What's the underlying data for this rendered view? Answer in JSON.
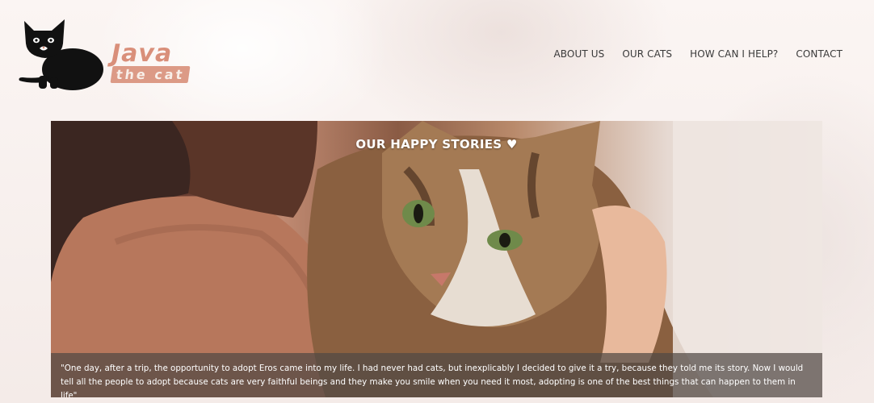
{
  "header": {
    "logo": {
      "line1": "Java",
      "line2": "the cat"
    },
    "nav": [
      {
        "label": "ABOUT US"
      },
      {
        "label": "OUR CATS"
      },
      {
        "label": "HOW CAN I HELP?"
      },
      {
        "label": "CONTACT"
      }
    ]
  },
  "hero": {
    "title": "OUR HAPPY STORIES ♥",
    "quote": "\"One day, after a trip, the opportunity to adopt Eros came into my life. I had never had cats, but inexplicably I decided to give it a try, because they told me its story. Now I would tell all the people to adopt because cats are very faithful beings and they make you smile when you need it most, adopting is one of the best things that can happen to them in life\""
  },
  "colors": {
    "brand": "#d98f7a",
    "nav_text": "#3a3a3a",
    "quote_bg": "rgba(80,72,68,0.72)"
  }
}
